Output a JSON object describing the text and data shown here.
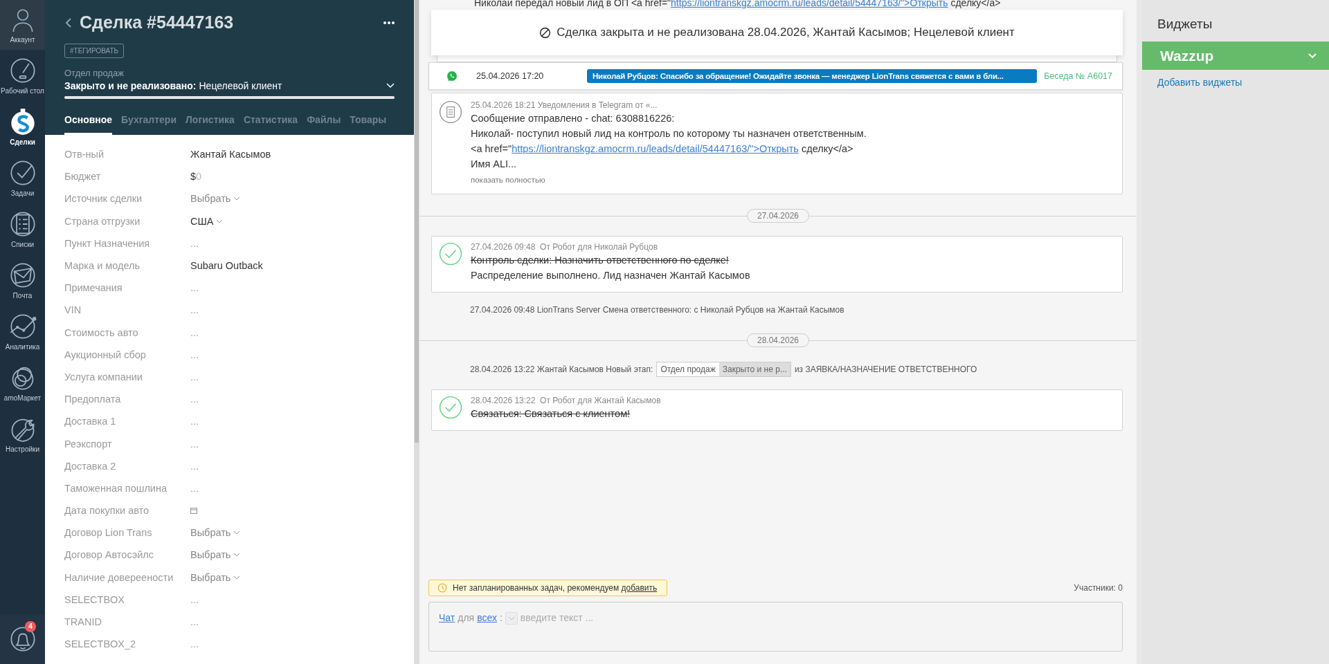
{
  "nav": {
    "items": [
      {
        "label": "Аккаунт",
        "selected": false
      },
      {
        "label": "Рабочий стол",
        "selected": false
      },
      {
        "label": "Сделки",
        "selected": true
      },
      {
        "label": "Задачи",
        "selected": false
      },
      {
        "label": "Списки",
        "selected": false
      },
      {
        "label": "Почта",
        "selected": false
      },
      {
        "label": "Аналитика",
        "selected": false
      },
      {
        "label": "amoМаркет",
        "selected": false
      },
      {
        "label": "Настройки",
        "selected": false
      }
    ],
    "notifications": {
      "count": "4"
    }
  },
  "deal": {
    "title": "Сделка #54447163",
    "tag_button": "#ТЕГИРОВАТЬ",
    "pipeline": "Отдел продаж",
    "status": "Закрыто и не реализовано:",
    "reason": "Нецелевой клиент",
    "level": 1,
    "tabs": [
      {
        "label": "Основное",
        "selected": true
      },
      {
        "label": "Бухгалтери",
        "selected": false
      },
      {
        "label": "Логистика",
        "selected": false
      },
      {
        "label": "Статистика",
        "selected": false
      },
      {
        "label": "Файлы",
        "selected": false
      },
      {
        "label": "Товары",
        "selected": false
      }
    ],
    "fields": [
      {
        "label": "Отв-ный",
        "kind": "text",
        "value": "Жантай Касымов"
      },
      {
        "label": "Бюджет",
        "kind": "budget",
        "currency": "$",
        "value": "0"
      },
      {
        "label": "Источник сделки",
        "kind": "select",
        "placeholder": "Выбрать"
      },
      {
        "label": "Страна отгрузки",
        "kind": "select_set",
        "value": "США"
      },
      {
        "label": "Пункт Назначения",
        "kind": "empty",
        "placeholder": "..."
      },
      {
        "label": "Марка и модель",
        "kind": "text",
        "value": "Subaru Outback"
      },
      {
        "label": "Примечания",
        "kind": "empty",
        "placeholder": "..."
      },
      {
        "label": "VIN",
        "kind": "empty",
        "placeholder": "..."
      },
      {
        "label": "Стоимость авто",
        "kind": "empty",
        "placeholder": "..."
      },
      {
        "label": "Аукционный сбор",
        "kind": "empty",
        "placeholder": "..."
      },
      {
        "label": "Услуга компании",
        "kind": "empty",
        "placeholder": "..."
      },
      {
        "label": "Предоплата",
        "kind": "empty",
        "placeholder": "..."
      },
      {
        "label": "Доставка 1",
        "kind": "empty",
        "placeholder": "..."
      },
      {
        "label": "Реэкспорт",
        "kind": "empty",
        "placeholder": "..."
      },
      {
        "label": "Доставка 2",
        "kind": "empty",
        "placeholder": "..."
      },
      {
        "label": "Таможенная пошлина",
        "kind": "empty",
        "placeholder": "..."
      },
      {
        "label": "Дата покупки авто",
        "kind": "date"
      },
      {
        "label": "Договор Lion Trans",
        "kind": "select",
        "placeholder": "Выбрать"
      },
      {
        "label": "Договор Автосэйлс",
        "kind": "select",
        "placeholder": "Выбрать"
      },
      {
        "label": "Наличие довереености",
        "kind": "select",
        "placeholder": "Выбрать"
      },
      {
        "label": "SELECTBOX",
        "kind": "empty",
        "placeholder": "..."
      },
      {
        "label": "TRANID",
        "kind": "empty",
        "placeholder": "..."
      },
      {
        "label": "SELECTBOX_2",
        "kind": "empty",
        "placeholder": "..."
      }
    ]
  },
  "feed": {
    "cut_line": {
      "pre": "Николай передал новый лид в ОП <a href=\"",
      "link": "https://liontranskgz.amocrm.ru/leads/detail/54447163/\">Открыть",
      "post": " сделку</a>"
    },
    "closed_banner": "Сделка закрыта и не реализована 28.04.2026, Жантай Касымов; Нецелевой клиент",
    "items": [
      {
        "kind": "chat",
        "time": "25.04.2026 17:20",
        "message": "Николай Рубцов: Спасибо за обращение! Ожидайте звонка — менеджер LionTrans свяжется с вами в бли...",
        "conversation": "Беседа № A6017"
      },
      {
        "kind": "note",
        "header": "25.04.2026 18:21 Уведомления в Telegram от «...",
        "lines": [
          {
            "pre": "Сообщение отправлено - chat: 6308816226:"
          },
          {
            "pre": "Николай- поступил новый лид на контроль по которому ты назначен ответственным."
          },
          {
            "pre": "<a href=\"",
            "link": "https://liontranskgz.amocrm.ru/leads/detail/54447163/\">Открыть",
            "post": " сделку</a>"
          },
          {
            "pre": "Имя ALI..."
          }
        ],
        "more": "показать полностью"
      },
      {
        "kind": "date",
        "label": "27.04.2026"
      },
      {
        "kind": "task",
        "completed": true,
        "time": "27.04.2026 09:48",
        "author": "От Робот для Николай Рубцов",
        "text": "Контроль сделки: Назначить ответственного по сделке!",
        "result": "Распределение выполнено. Лид назначен Жантай Касымов"
      },
      {
        "kind": "event",
        "text": "27.04.2026 09:48 LionTrans Server Смена ответственного: с Николай Рубцов на Жантай Касымов"
      },
      {
        "kind": "date",
        "label": "28.04.2026"
      },
      {
        "kind": "stage",
        "text": "28.04.2026 13:22 Жантай Касымов Новый этап:",
        "pipeline": "Отдел продаж",
        "stage": "Закрыто и не р...",
        "from": "из ЗАЯВКА/НАЗНАЧЕНИЕ ОТВЕТСТВЕННОГО"
      },
      {
        "kind": "task",
        "completed": true,
        "time": "28.04.2026 13:22",
        "author": "От Робот для Жантай Касымов",
        "text": "Связаться: Связаться с клиентом!"
      }
    ],
    "no_tasks": {
      "text": "Нет запланированных задач, рекомендуем",
      "link": "добавить"
    },
    "participants": "Участники: 0",
    "composer": {
      "mode": "Чат",
      "for": "для",
      "target": "всех",
      "colon": ":",
      "placeholder": "введите текст ..."
    }
  },
  "widgets": {
    "title": "Виджеты",
    "items": [
      {
        "name": "Wazzup",
        "color": "#66bb6a"
      }
    ],
    "add_link": "Добавить виджеты"
  }
}
